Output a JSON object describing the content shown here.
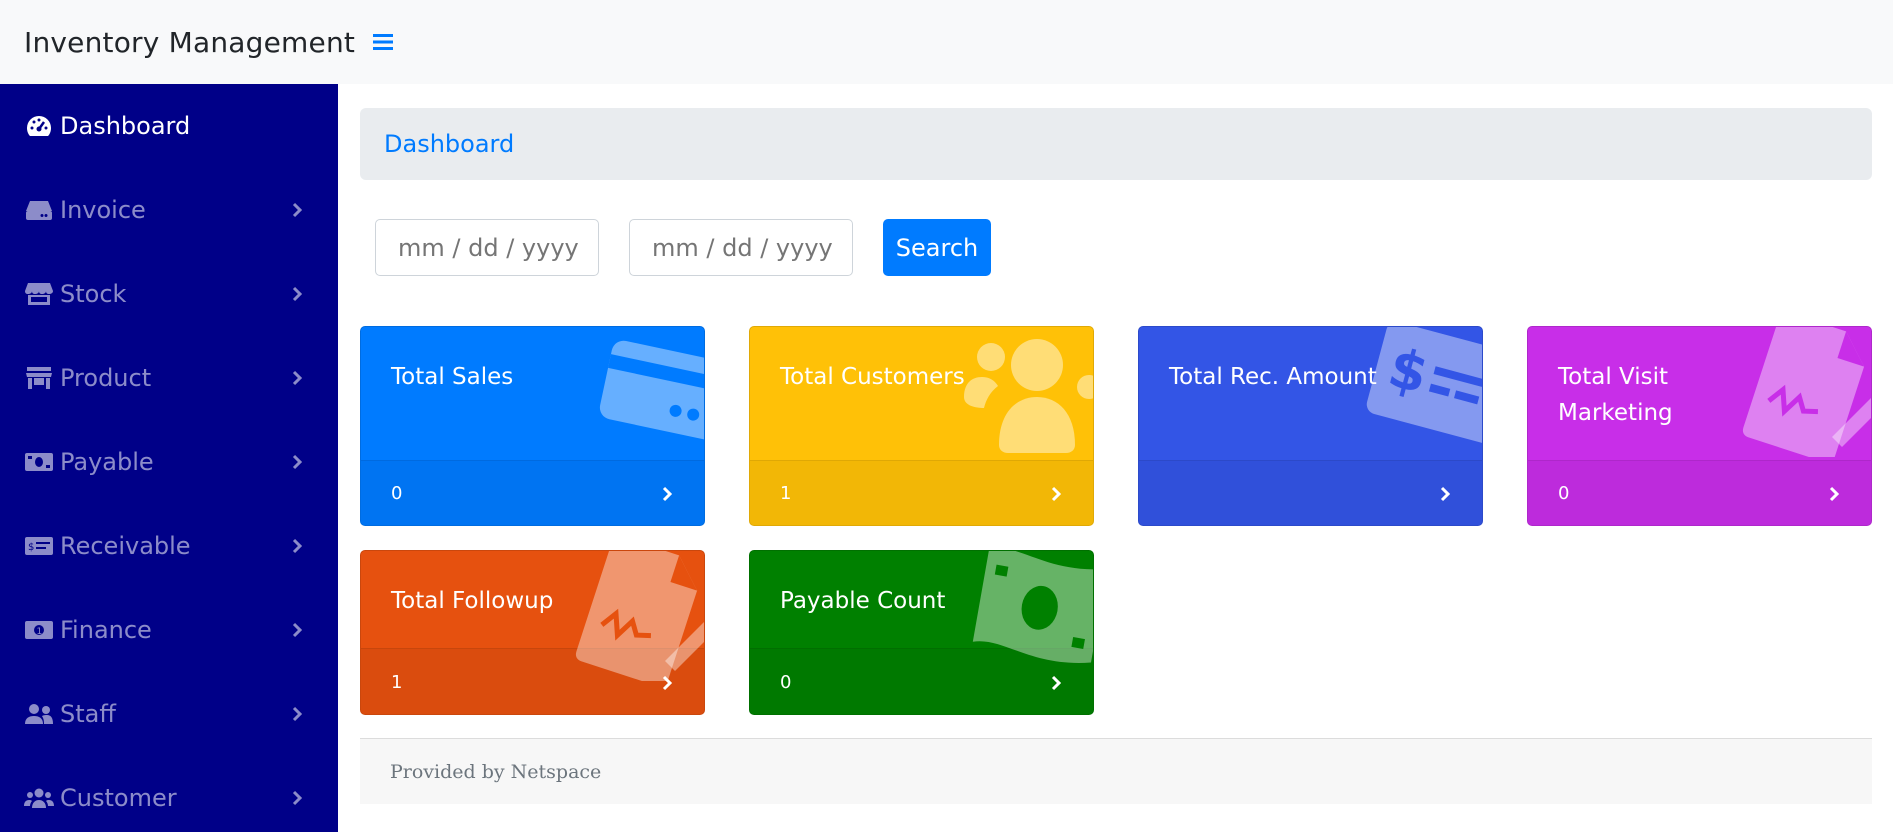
{
  "app": {
    "title": "Inventory Management",
    "toggle_icon": "hamburger-icon",
    "accent_color": "#007bff",
    "sidebar_color": "#000088"
  },
  "sidebar": {
    "items": [
      {
        "label": "Dashboard",
        "icon": "tachometer-icon",
        "active": true
      },
      {
        "label": "Invoice",
        "icon": "hdd-icon",
        "active": false
      },
      {
        "label": "Stock",
        "icon": "store-icon",
        "active": false
      },
      {
        "label": "Product",
        "icon": "store-alt-icon",
        "active": false
      },
      {
        "label": "Payable",
        "icon": "money-bill-icon",
        "active": false
      },
      {
        "label": "Receivable",
        "icon": "money-check-icon",
        "active": false
      },
      {
        "label": "Finance",
        "icon": "money-bill-alt-icon",
        "active": false
      },
      {
        "label": "Staff",
        "icon": "user-friends-icon",
        "active": false
      },
      {
        "label": "Customer",
        "icon": "users-icon",
        "active": false
      }
    ]
  },
  "breadcrumb": {
    "label": "Dashboard"
  },
  "filters": {
    "from_date_placeholder": "mm / dd / yyyy",
    "to_date_placeholder": "mm / dd / yyyy",
    "search_label": "Search"
  },
  "cards": [
    {
      "title": "Total Sales",
      "value": "0",
      "color": "#007bff",
      "icon": "credit-card-icon"
    },
    {
      "title": "Total Customers",
      "value": "1",
      "color": "#ffc107",
      "icon": "users-icon"
    },
    {
      "title": "Total Rec. Amount",
      "value": "",
      "color": "#3355e6",
      "icon": "money-check-alt-icon"
    },
    {
      "title": "Total Visit Marketing",
      "value": "0",
      "color": "#c82ee8",
      "icon": "file-signature-icon"
    },
    {
      "title": "Total Followup",
      "value": "1",
      "color": "#e6510f",
      "icon": "file-signature-icon"
    },
    {
      "title": "Payable Count",
      "value": "0",
      "color": "#008000",
      "icon": "money-bill-wave-icon"
    }
  ],
  "footer": {
    "text": "Provided by Netspace"
  }
}
